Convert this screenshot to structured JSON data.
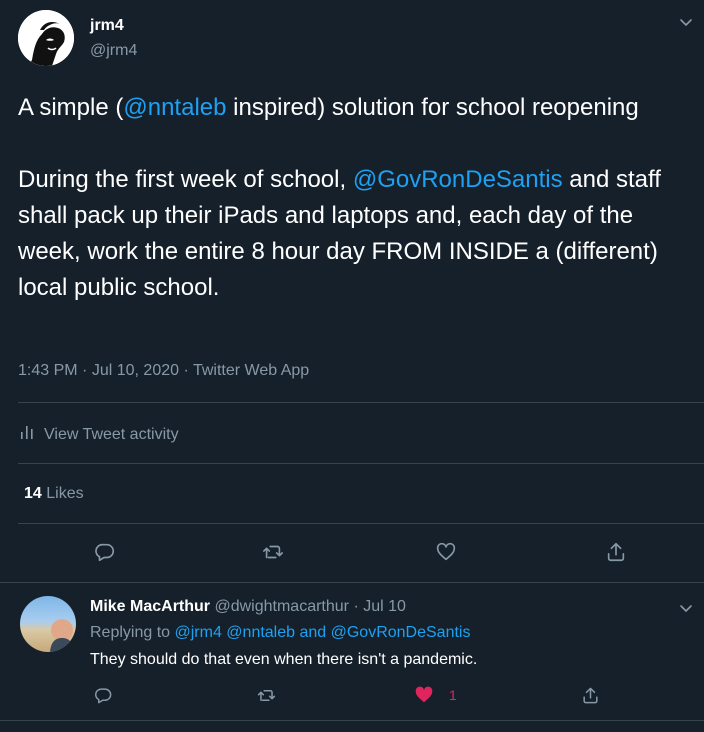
{
  "tweet": {
    "author_name": "jrm4",
    "author_handle": "@jrm4",
    "text_part1": "A simple (",
    "mention1": "@nntaleb",
    "text_part2": " inspired) solution for school reopening\n\nDuring the first week of school, ",
    "mention2": "@GovRonDeSantis",
    "text_part3": " and staff shall pack up their iPads and laptops and, each day of the week, work the entire 8 hour day FROM INSIDE a (different) local public school.",
    "time": "1:43 PM",
    "date": "Jul 10, 2020",
    "source": "Twitter Web App",
    "activity_label": "View Tweet activity",
    "likes_count": "14",
    "likes_label": "Likes"
  },
  "reply": {
    "author_name": "Mike MacArthur",
    "author_handle": "@dwightmacarthur",
    "date": "Jul 10",
    "replying_label": "Replying to",
    "replying_to": "@jrm4 @nntaleb and @GovRonDeSantis",
    "text": "They should do that even when there isn't a pandemic.",
    "like_count": "1"
  },
  "colors": {
    "background": "#15202b",
    "link": "#1da1f2",
    "muted": "#8899a6",
    "like_red": "#e0245e"
  },
  "icons": [
    "chevron-down-icon",
    "reply-icon",
    "retweet-icon",
    "like-icon",
    "share-icon",
    "activity-chart-icon"
  ]
}
